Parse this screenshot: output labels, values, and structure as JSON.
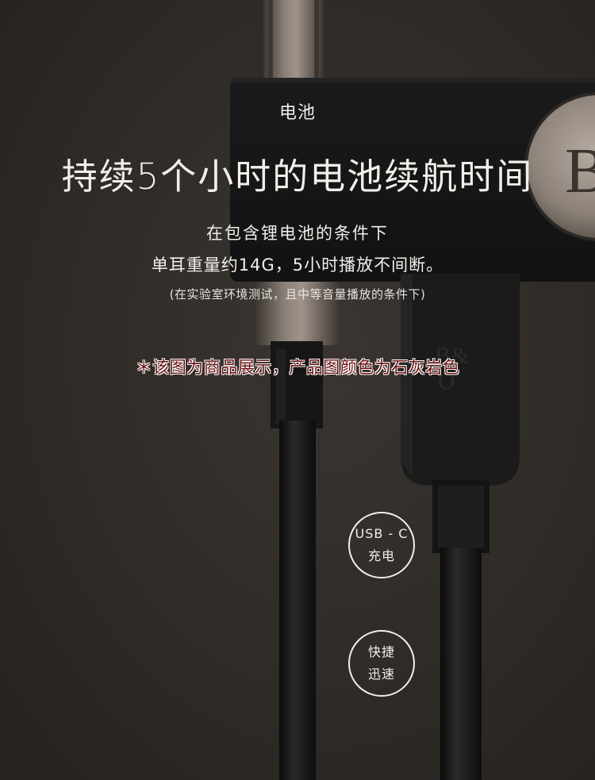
{
  "label": "电池",
  "headline": "持续5个小时的电池续航时间",
  "line1": "在包含锂电池的条件下",
  "line2": "单耳重量约14G，5小时播放不间断。",
  "note": "(在实验室环境测试，且中等音量播放的条件下)",
  "notice": "＊该图为商品展示，产品图颜色为石灰岩色",
  "badges": [
    {
      "line1": "USB - C",
      "line2": "充电"
    },
    {
      "line1": "快捷",
      "line2": "迅速"
    }
  ],
  "logo": "B&O"
}
